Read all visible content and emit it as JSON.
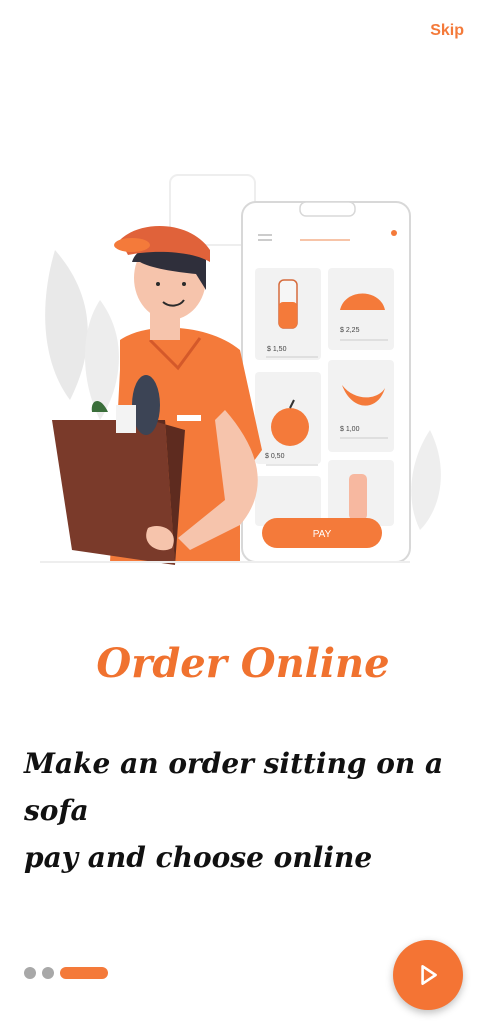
{
  "header": {
    "skip_label": "Skip"
  },
  "illustration": {
    "prices": [
      "$ 1,50",
      "$ 2,25",
      "$ 0,50",
      "$ 1,00"
    ],
    "pay_label": "PAY"
  },
  "onboarding": {
    "title": "Order Online",
    "description_lines": [
      "Make an order sitting on a",
      "sofa",
      "pay and choose online"
    ]
  },
  "pager": {
    "total": 3,
    "active_index": 2
  },
  "colors": {
    "accent": "#f47a3a",
    "dot_inactive": "#a8a8a8",
    "text": "#111111"
  },
  "icons": {
    "next": "play-arrow-icon"
  }
}
